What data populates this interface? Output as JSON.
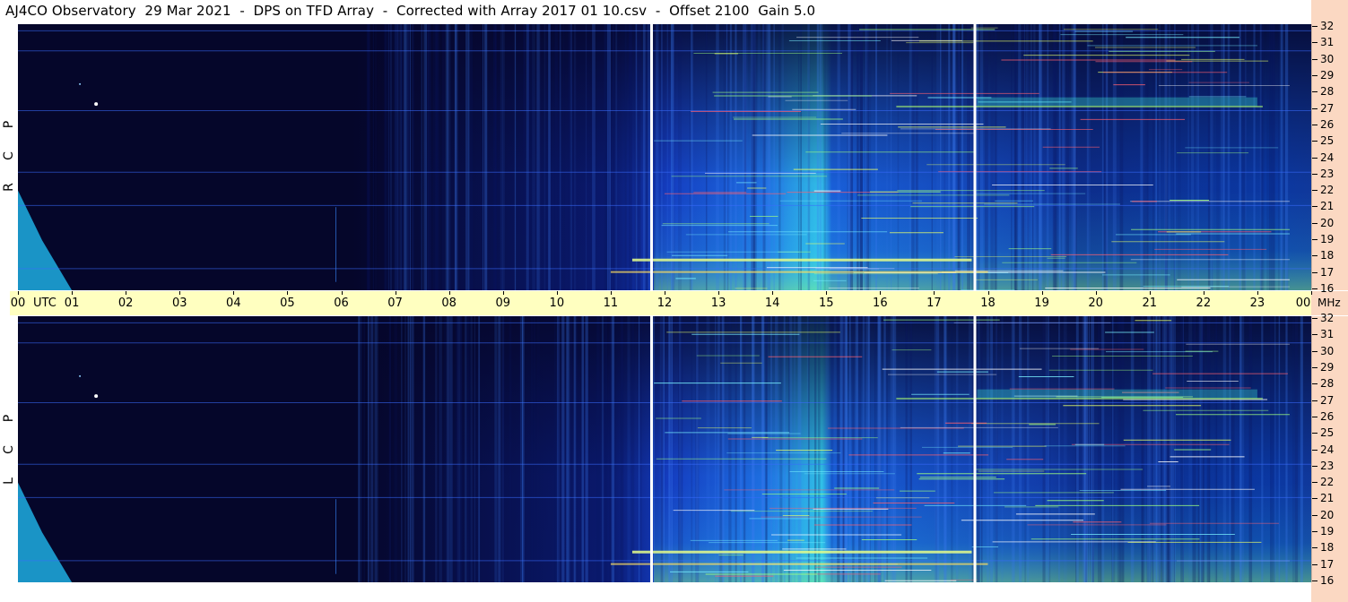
{
  "title": "AJ4CO Observatory  29 Mar 2021  -  DPS on TFD Array  -  Corrected with Array 2017 01 10.csv  -  Offset 2100  Gain 5.0",
  "panels": [
    {
      "id": "rcp",
      "polarization": [
        "R",
        "C",
        "P"
      ]
    },
    {
      "id": "lcp",
      "polarization": [
        "L",
        "C",
        "P"
      ]
    }
  ],
  "chart_data": {
    "type": "heatmap",
    "title": "AJ4CO Observatory  29 Mar 2021  -  DPS on TFD Array  -  Corrected with Array 2017 01 10.csv  -  Offset 2100  Gain 5.0",
    "x_unit_label": "UTC",
    "y_unit_label": "MHz",
    "x_ticks": [
      "00",
      "01",
      "02",
      "03",
      "04",
      "05",
      "06",
      "07",
      "08",
      "09",
      "10",
      "11",
      "12",
      "13",
      "14",
      "15",
      "16",
      "17",
      "18",
      "19",
      "20",
      "21",
      "22",
      "23",
      "00"
    ],
    "xlim_hours": [
      0,
      24
    ],
    "y_ticks": [
      "32",
      "31",
      "30",
      "29",
      "28",
      "27",
      "26",
      "25",
      "24",
      "23",
      "22",
      "21",
      "20",
      "19",
      "18",
      "17",
      "16"
    ],
    "ylim_mhz": [
      16,
      32
    ],
    "series": [
      {
        "name": "RCP"
      },
      {
        "name": "LCP"
      }
    ],
    "marker_lines_utc_hours": [
      11.75,
      17.75
    ],
    "colors": {
      "background_low": "#05062a",
      "mid": "#1a5ce0",
      "high": "#33c9f0",
      "peak": "#d8ff5a",
      "marker": "#ffffff",
      "time_axis_bg": "#ffffc0",
      "freq_axis_bg": "#fbd8c2"
    }
  }
}
